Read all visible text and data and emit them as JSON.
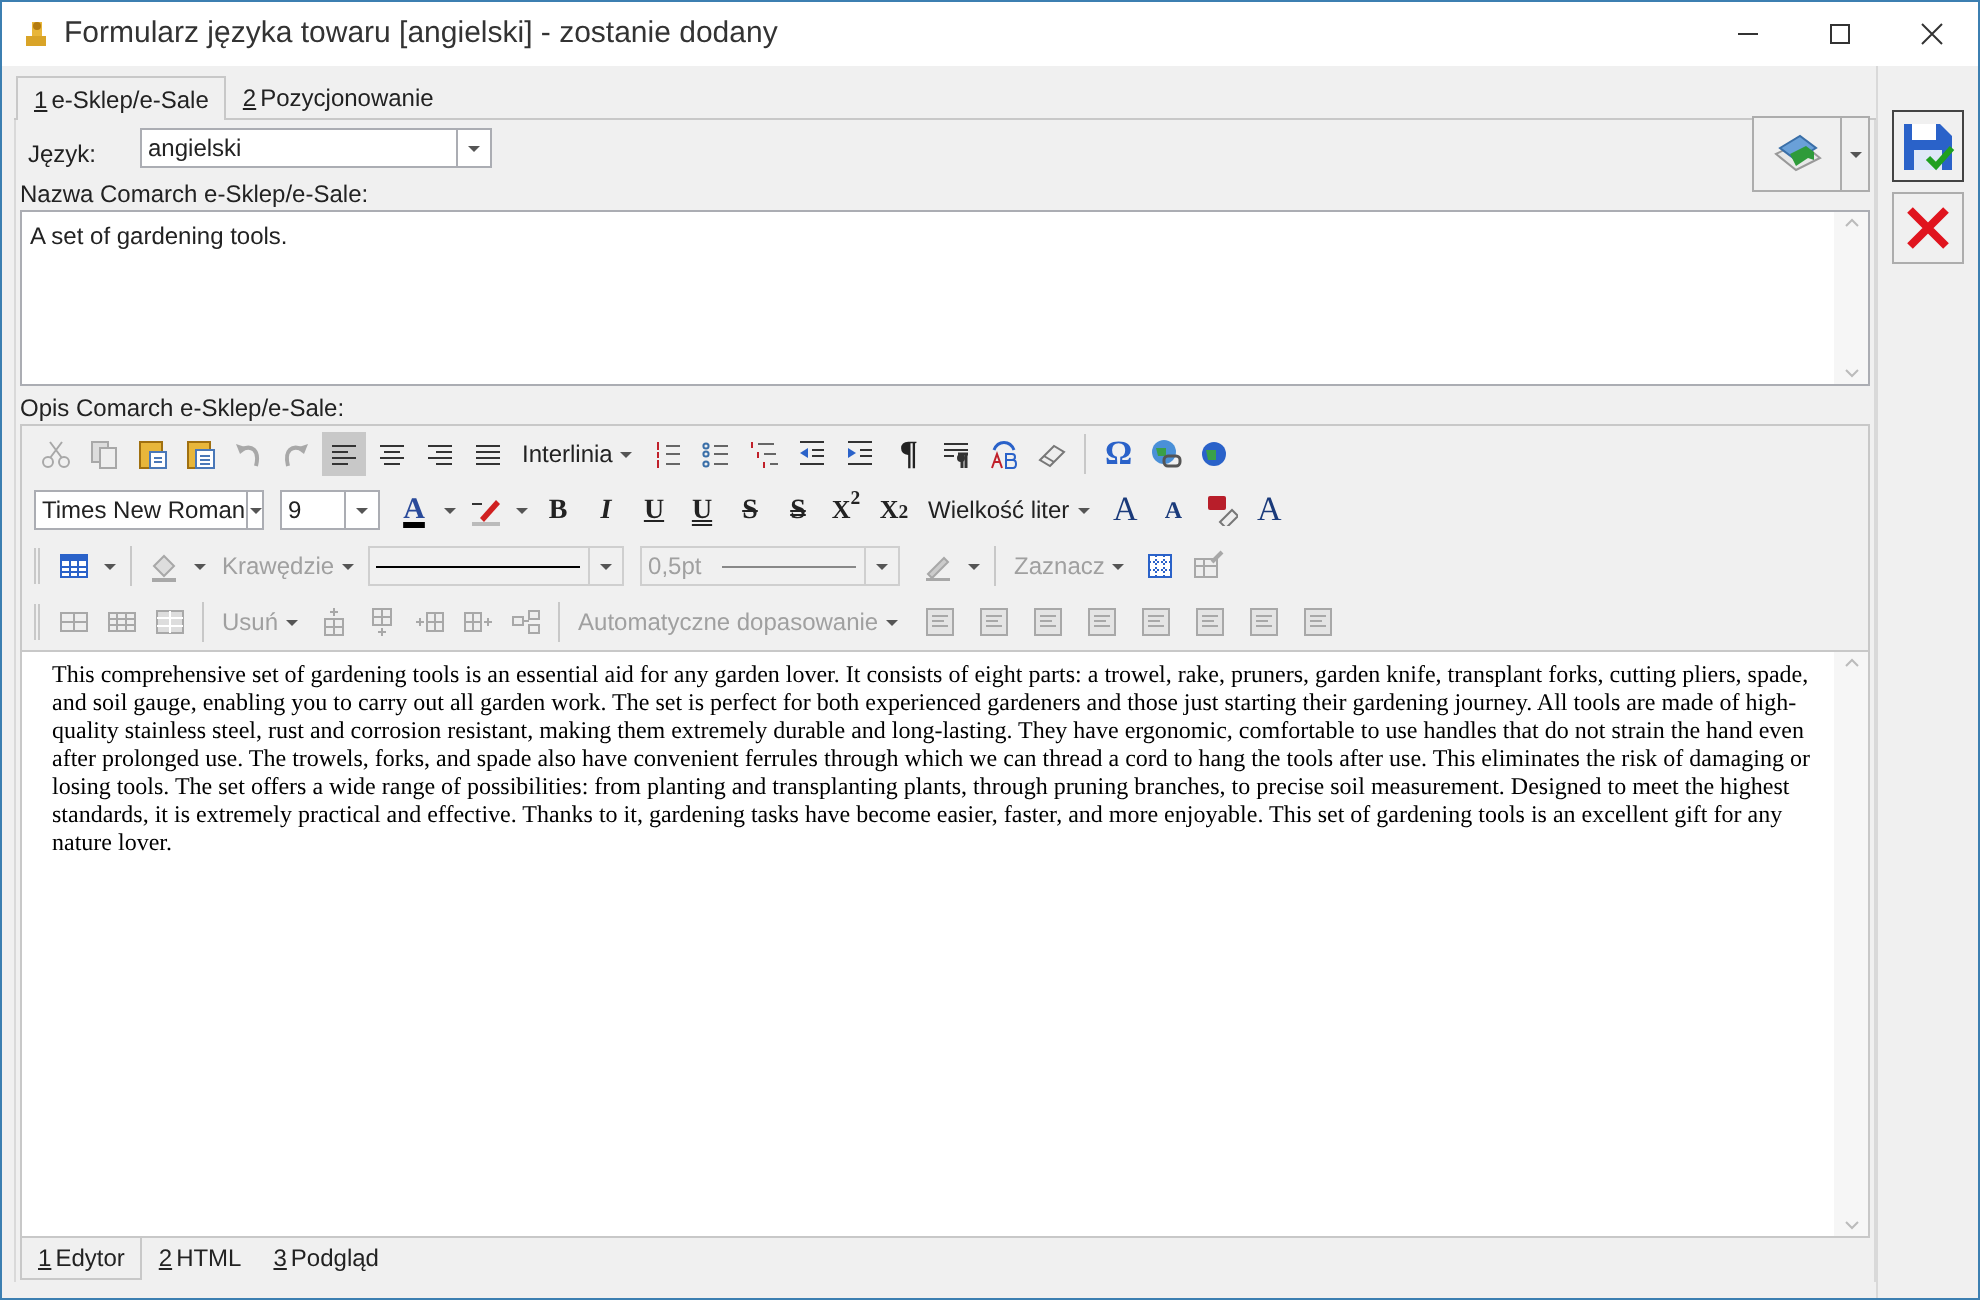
{
  "window": {
    "title": "Formularz języka towaru [angielski] - zostanie dodany"
  },
  "tabs": [
    {
      "mnemonic": "1",
      "label": "e-Sklep/e-Sale",
      "selected": true
    },
    {
      "mnemonic": "2",
      "label": "Pozycjonowanie",
      "selected": false
    }
  ],
  "language": {
    "label": "Język:",
    "value": "angielski"
  },
  "name_field": {
    "label": "Nazwa Comarch e-Sklep/e-Sale:",
    "value": "A set of gardening tools."
  },
  "description": {
    "label": "Opis Comarch e-Sklep/e-Sale:"
  },
  "toolbar": {
    "alignment": [
      {
        "selected": true
      },
      {
        "selected": false
      },
      {
        "selected": false
      },
      {
        "selected": false
      }
    ],
    "line_spacing": {
      "label": "Interlinia",
      "disabled": false
    },
    "font": {
      "value": "Times New Roman"
    },
    "size": {
      "value": "9"
    },
    "letter_case": {
      "label": "Wielkość liter",
      "disabled": false
    },
    "borders": {
      "label": "Krawędzie",
      "disabled": true
    },
    "border_width": {
      "value": "0,5pt",
      "disabled": true
    },
    "select": {
      "label": "Zaznacz",
      "disabled": true
    },
    "delete": {
      "label": "Usuń",
      "disabled": true
    },
    "autofit": {
      "label": "Automatyczne dopasowanie",
      "disabled": true
    },
    "glyphs": [
      "¶",
      "Ω",
      "A",
      "B",
      "I",
      "U",
      "U",
      "S",
      "S",
      "X$^{2}$",
      "X$_{2}$",
      "A",
      "A",
      "A"
    ]
  },
  "editor": {
    "text": "This comprehensive set of gardening tools is an essential aid for any garden lover. It consists of eight parts: a trowel, rake, pruners, garden knife, transplant forks, cutting pliers, spade, and soil gauge, enabling you to carry out all garden work. The set is perfect for both experienced gardeners and those just starting their gardening journey. All tools are made of high-quality stainless steel, rust and corrosion resistant, making them extremely durable and long-lasting. They have ergonomic, comfortable to use handles that do not strain the hand even after prolonged use. The trowels, forks, and spade also have convenient ferrules through which we can thread a cord to hang the tools after use. This eliminates the risk of damaging or losing tools. The set offers a wide range of possibilities: from planting and transplanting plants, through pruning branches, to precise soil measurement. Designed to meet the highest standards, it is extremely practical and effective. Thanks to it, gardening tasks have become easier, faster, and more enjoyable. This set of gardening tools is an excellent gift for any nature lover."
  },
  "bottom_tabs": [
    {
      "mnemonic": "1",
      "label": "Edytor",
      "selected": true
    },
    {
      "mnemonic": "2",
      "label": "HTML",
      "selected": false
    },
    {
      "mnemonic": "3",
      "label": "Podgląd",
      "selected": false
    }
  ]
}
